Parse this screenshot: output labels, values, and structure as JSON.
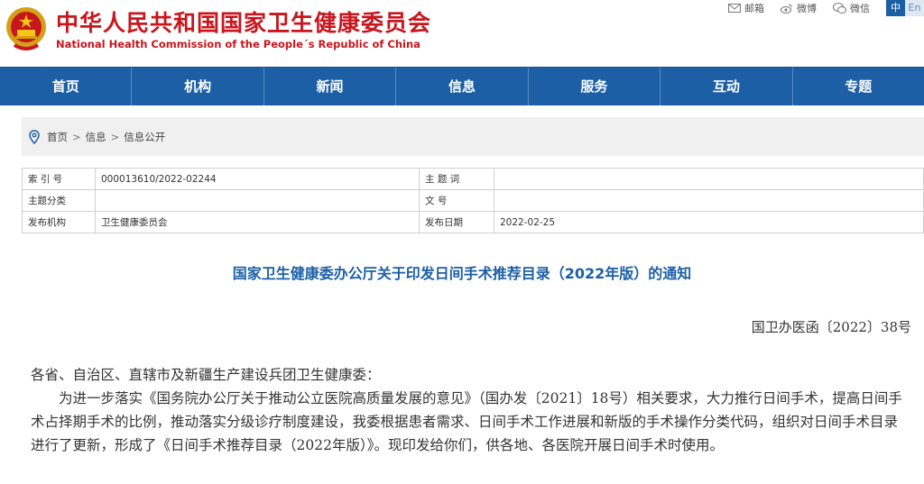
{
  "header": {
    "title_cn": "中华人民共和国国家卫生健康委员会",
    "title_en": "National Health Commission of the People´s Republic of China",
    "links": [
      {
        "label": "邮箱",
        "icon": "mail-icon"
      },
      {
        "label": "微博",
        "icon": "weibo-icon"
      },
      {
        "label": "微信",
        "icon": "wechat-icon"
      }
    ],
    "lang_cn": "中",
    "lang_en": "En"
  },
  "nav": {
    "items": [
      "首页",
      "机构",
      "新闻",
      "信息",
      "服务",
      "互动",
      "专题"
    ]
  },
  "breadcrumb": {
    "items": [
      "首页",
      "信息",
      "信息公开"
    ],
    "separator": ">"
  },
  "meta": {
    "rows": [
      {
        "label1": "索 引 号",
        "value1": "000013610/2022-02244",
        "label2": "主 题 词",
        "value2": ""
      },
      {
        "label1": "主题分类",
        "value1": "",
        "label2": "文    号",
        "value2": ""
      },
      {
        "label1": "发布机构",
        "value1": "卫生健康委员会",
        "label2": "发布日期",
        "value2": "2022-02-25"
      }
    ]
  },
  "document": {
    "title": "国家卫生健康委办公厅关于印发日间手术推荐目录（2022年版）的通知",
    "number": "国卫办医函〔2022〕38号",
    "salutation": "各省、自治区、直辖市及新疆生产建设兵团卫生健康委：",
    "paragraph": "为进一步落实《国务院办公厅关于推动公立医院高质量发展的意见》（国办发〔2021〕18号）相关要求，大力推行日间手术，提高日间手术占择期手术的比例，推动落实分级诊疗制度建设，我委根据患者需求、日间手术工作进展和新版的手术操作分类代码，组织对日间手术目录进行了更新，形成了《日间手术推荐目录（2022年版）》。现印发给你们，供各地、各医院开展日间手术时使用。"
  },
  "colors": {
    "brand_red": "#c8161d",
    "nav_blue": "#1c5fa5",
    "title_blue": "#1c5fa5"
  }
}
